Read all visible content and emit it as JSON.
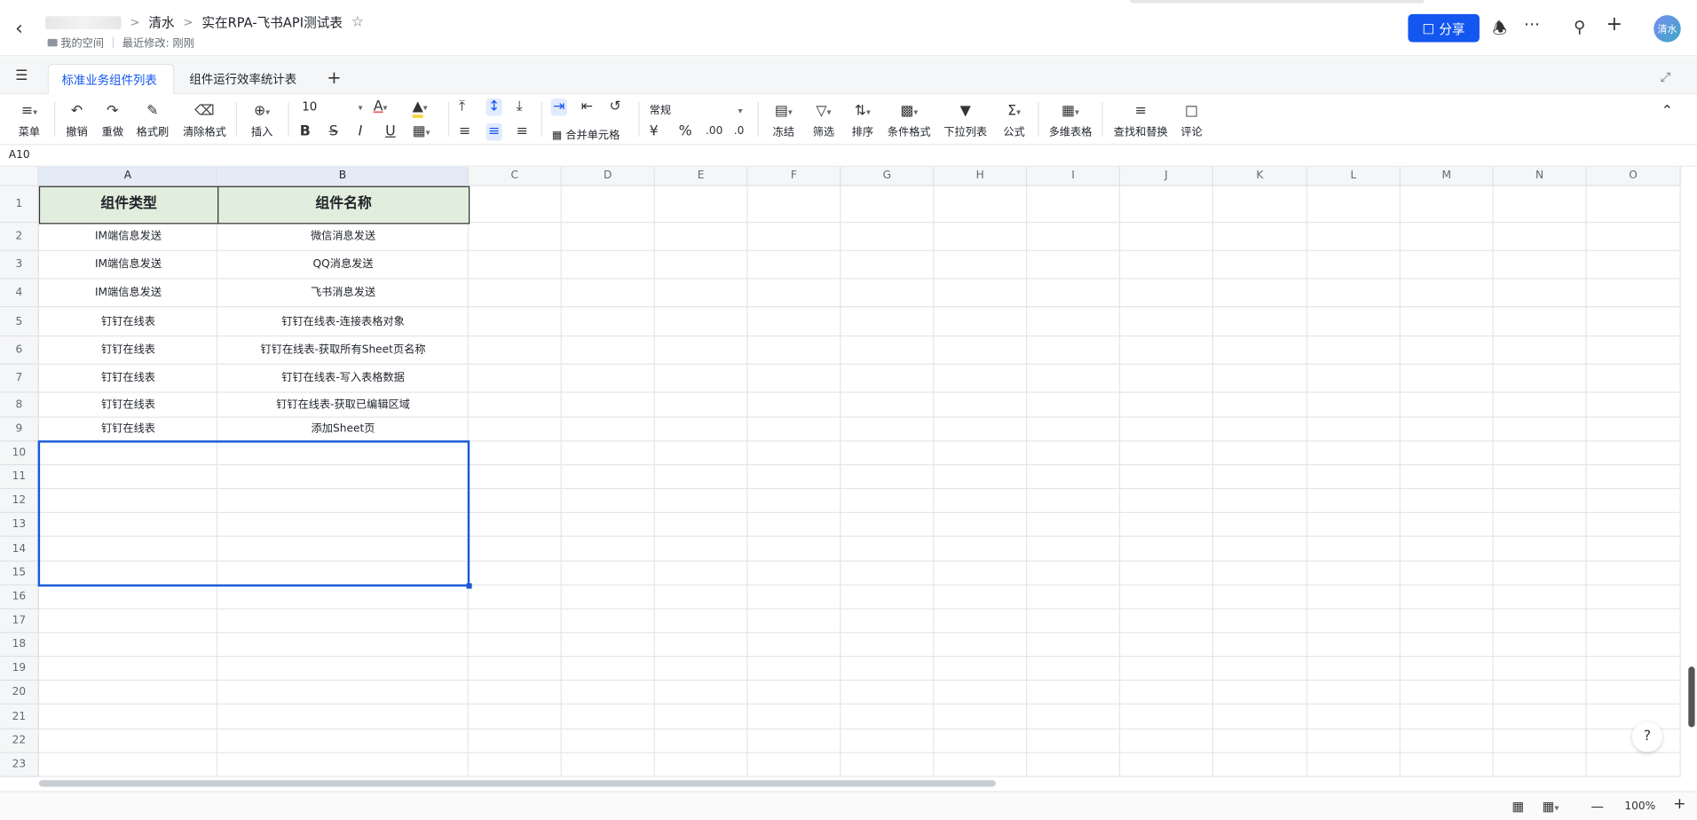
{
  "header": {
    "breadcrumb": [
      "清水",
      "实在RPA-飞书API测试表"
    ],
    "location": "我的空间",
    "modified": "最近修改: 刚刚",
    "share_label": "分享",
    "avatar_text": "清水"
  },
  "tabs": [
    {
      "label": "标准业务组件列表",
      "active": true
    },
    {
      "label": "组件运行效率统计表",
      "active": false
    }
  ],
  "toolbar": {
    "menu": "菜单",
    "undo": "撤销",
    "redo": "重做",
    "format_painter": "格式刷",
    "clear_format": "清除格式",
    "insert": "插入",
    "font_size": "10",
    "merge": "合并单元格",
    "number_format": "常规",
    "freeze": "冻结",
    "filter": "筛选",
    "sort": "排序",
    "cond_format": "条件格式",
    "dropdown": "下拉列表",
    "formula": "公式",
    "multi_table": "多维表格",
    "find_replace": "查找和替换",
    "comment": "评论"
  },
  "cell_ref": "A10",
  "columns": [
    "A",
    "B",
    "C",
    "D",
    "E",
    "F",
    "G",
    "H",
    "I",
    "J",
    "K",
    "L",
    "M",
    "N",
    "O"
  ],
  "rows": [
    "1",
    "2",
    "3",
    "4",
    "5",
    "6",
    "7",
    "8",
    "9",
    "10",
    "11",
    "12",
    "13",
    "14",
    "15",
    "16",
    "17",
    "18",
    "19",
    "20",
    "21",
    "22",
    "23"
  ],
  "table": {
    "headers": [
      "组件类型",
      "组件名称"
    ],
    "data": [
      [
        "IM端信息发送",
        "微信消息发送"
      ],
      [
        "IM端信息发送",
        "QQ消息发送"
      ],
      [
        "IM端信息发送",
        "飞书消息发送"
      ],
      [
        "钉钉在线表",
        "钉钉在线表-连接表格对象"
      ],
      [
        "钉钉在线表",
        "钉钉在线表-获取所有Sheet页名称"
      ],
      [
        "钉钉在线表",
        "钉钉在线表-写入表格数据"
      ],
      [
        "钉钉在线表",
        "钉钉在线表-获取已编辑区域"
      ],
      [
        "钉钉在线表",
        "添加Sheet页"
      ]
    ]
  },
  "statusbar": {
    "zoom": "100%"
  },
  "colors": {
    "accent": "#1456f0",
    "header_fill": "#e2eedd",
    "selection": "#1a5ad7"
  }
}
